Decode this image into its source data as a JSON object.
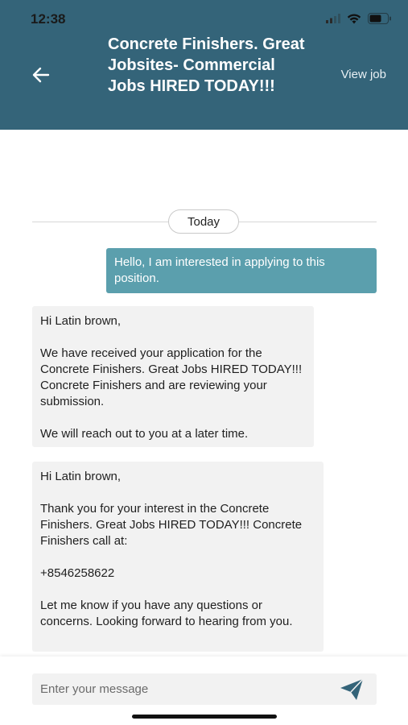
{
  "status_bar": {
    "time": "12:38"
  },
  "header": {
    "title": "Concrete Finishers. Great Jobsites- Commercial Jobs HIRED TODAY!!!",
    "view_job": "View job"
  },
  "date_separator": "Today",
  "messages": {
    "sent": "Hello, I am interested in applying to this position.",
    "recv1": {
      "greeting": "Hi Latin brown,",
      "body": "We have received your application for the Concrete Finishers. Great Jobs HIRED TODAY!!! Concrete Finishers and are reviewing your submission.",
      "closing": "We will reach out to you at a later time."
    },
    "recv2": {
      "greeting": "Hi Latin brown,",
      "body": "Thank you for your interest in the Concrete Finishers. Great Jobs HIRED TODAY!!! Concrete Finishers call at:",
      "phone": "+8546258622",
      "closing": "Let me know if you have any questions or concerns. Looking forward to hearing from you."
    }
  },
  "composer": {
    "placeholder": "Enter your message"
  },
  "colors": {
    "header": "#346479",
    "sent_bubble": "#5b9fad",
    "received_bubble": "#f2f2f2",
    "send_icon": "#346479"
  },
  "icons": {
    "back": "arrow-left-icon",
    "send": "paper-plane-icon",
    "signal": "signal-icon",
    "wifi": "wifi-icon",
    "battery": "battery-icon"
  }
}
